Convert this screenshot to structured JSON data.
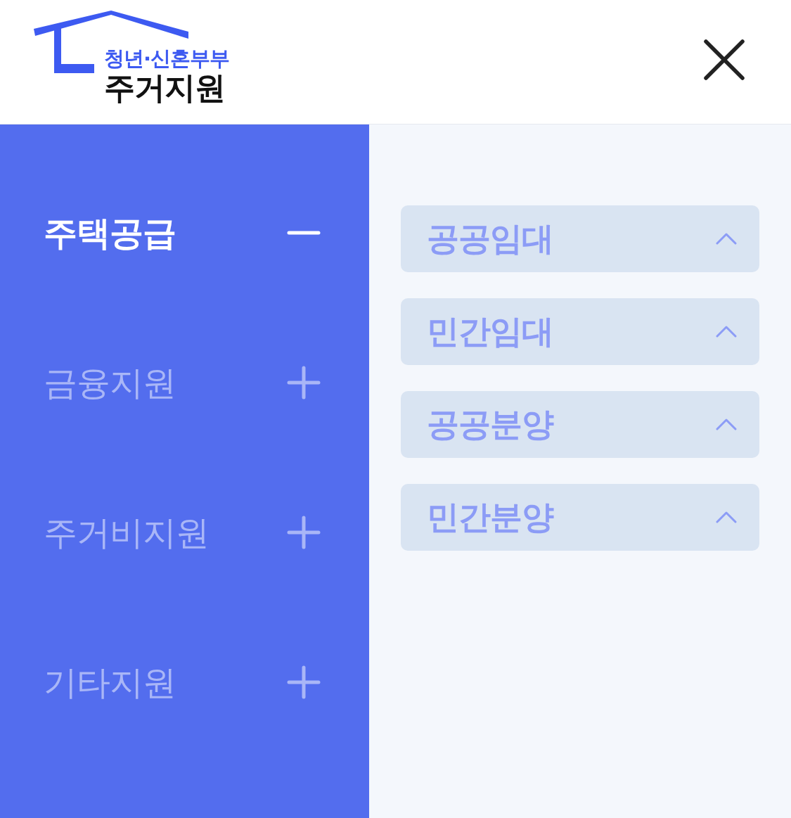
{
  "logo": {
    "tagline": "청년·신혼부부",
    "title": "주거지원"
  },
  "menu": [
    {
      "label": "주택공급",
      "selected": true,
      "expanded": true
    },
    {
      "label": "금융지원",
      "selected": false,
      "expanded": false
    },
    {
      "label": "주거비지원",
      "selected": false,
      "expanded": false
    },
    {
      "label": "기타지원",
      "selected": false,
      "expanded": false
    }
  ],
  "submenu": [
    {
      "label": "공공임대"
    },
    {
      "label": "민간임대"
    },
    {
      "label": "공공분양"
    },
    {
      "label": "민간분양"
    }
  ]
}
